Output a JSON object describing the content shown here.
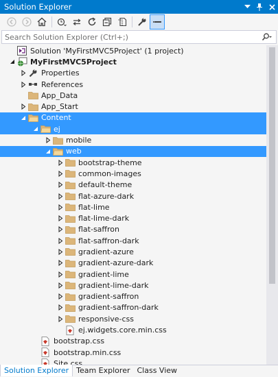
{
  "window": {
    "title": "Solution Explorer"
  },
  "search": {
    "placeholder": "Search Solution Explorer (Ctrl+;)"
  },
  "toolbar": [
    "back",
    "forward",
    "home",
    "pending-changes",
    "sync",
    "refresh",
    "collapse-all",
    "show-all-files",
    "properties",
    "preview"
  ],
  "tree": [
    {
      "label": "Solution 'MyFirstMVC5Project' (1 project)",
      "level": 0,
      "icon": "solution-icon",
      "expander": "",
      "selected": false,
      "bold": false
    },
    {
      "label": "MyFirstMVC5Project",
      "level": 0,
      "icon": "web-project-icon",
      "expander": "expanded",
      "selected": false,
      "bold": true
    },
    {
      "label": "Properties",
      "level": 1,
      "icon": "wrench-icon",
      "expander": "collapsed",
      "selected": false,
      "bold": false
    },
    {
      "label": "References",
      "level": 1,
      "icon": "references-icon",
      "expander": "collapsed",
      "selected": false,
      "bold": false
    },
    {
      "label": "App_Data",
      "level": 1,
      "icon": "folder-icon",
      "expander": "",
      "selected": false,
      "bold": false
    },
    {
      "label": "App_Start",
      "level": 1,
      "icon": "folder-icon",
      "expander": "collapsed",
      "selected": false,
      "bold": false
    },
    {
      "label": "Content",
      "level": 1,
      "icon": "open-folder-icon",
      "expander": "expanded",
      "selected": true,
      "bold": false
    },
    {
      "label": "ej",
      "level": 2,
      "icon": "open-folder-icon",
      "expander": "expanded",
      "selected": true,
      "bold": false
    },
    {
      "label": "mobile",
      "level": 3,
      "icon": "folder-icon",
      "expander": "collapsed",
      "selected": false,
      "bold": false
    },
    {
      "label": "web",
      "level": 3,
      "icon": "open-folder-icon",
      "expander": "expanded",
      "selected": true,
      "bold": false
    },
    {
      "label": "bootstrap-theme",
      "level": 4,
      "icon": "folder-icon",
      "expander": "collapsed",
      "selected": false,
      "bold": false
    },
    {
      "label": "common-images",
      "level": 4,
      "icon": "folder-icon",
      "expander": "collapsed",
      "selected": false,
      "bold": false
    },
    {
      "label": "default-theme",
      "level": 4,
      "icon": "folder-icon",
      "expander": "collapsed",
      "selected": false,
      "bold": false
    },
    {
      "label": "flat-azure-dark",
      "level": 4,
      "icon": "folder-icon",
      "expander": "collapsed",
      "selected": false,
      "bold": false
    },
    {
      "label": "flat-lime",
      "level": 4,
      "icon": "folder-icon",
      "expander": "collapsed",
      "selected": false,
      "bold": false
    },
    {
      "label": "flat-lime-dark",
      "level": 4,
      "icon": "folder-icon",
      "expander": "collapsed",
      "selected": false,
      "bold": false
    },
    {
      "label": "flat-saffron",
      "level": 4,
      "icon": "folder-icon",
      "expander": "collapsed",
      "selected": false,
      "bold": false
    },
    {
      "label": "flat-saffron-dark",
      "level": 4,
      "icon": "folder-icon",
      "expander": "collapsed",
      "selected": false,
      "bold": false
    },
    {
      "label": "gradient-azure",
      "level": 4,
      "icon": "folder-icon",
      "expander": "collapsed",
      "selected": false,
      "bold": false
    },
    {
      "label": "gradient-azure-dark",
      "level": 4,
      "icon": "folder-icon",
      "expander": "collapsed",
      "selected": false,
      "bold": false
    },
    {
      "label": "gradient-lime",
      "level": 4,
      "icon": "folder-icon",
      "expander": "collapsed",
      "selected": false,
      "bold": false
    },
    {
      "label": "gradient-lime-dark",
      "level": 4,
      "icon": "folder-icon",
      "expander": "collapsed",
      "selected": false,
      "bold": false
    },
    {
      "label": "gradient-saffron",
      "level": 4,
      "icon": "folder-icon",
      "expander": "collapsed",
      "selected": false,
      "bold": false
    },
    {
      "label": "gradient-saffron-dark",
      "level": 4,
      "icon": "folder-icon",
      "expander": "collapsed",
      "selected": false,
      "bold": false
    },
    {
      "label": "responsive-css",
      "level": 4,
      "icon": "folder-icon",
      "expander": "collapsed",
      "selected": false,
      "bold": false
    },
    {
      "label": "ej.widgets.core.min.css",
      "level": 4,
      "icon": "css-file-icon",
      "expander": "",
      "selected": false,
      "bold": false
    },
    {
      "label": "bootstrap.css",
      "level": 2,
      "icon": "css-file-icon",
      "expander": "",
      "selected": false,
      "bold": false
    },
    {
      "label": "bootstrap.min.css",
      "level": 2,
      "icon": "css-file-icon",
      "expander": "",
      "selected": false,
      "bold": false
    },
    {
      "label": "Site.css",
      "level": 2,
      "icon": "css-file-icon",
      "expander": "",
      "selected": false,
      "bold": false
    }
  ],
  "tabs": [
    {
      "label": "Solution Explorer",
      "active": true
    },
    {
      "label": "Team Explorer",
      "active": false
    },
    {
      "label": "Class View",
      "active": false
    }
  ],
  "colors": {
    "accent": "#007acc",
    "selection": "#3399ff",
    "folder": "#dcb67a",
    "css": "#c8392b"
  }
}
